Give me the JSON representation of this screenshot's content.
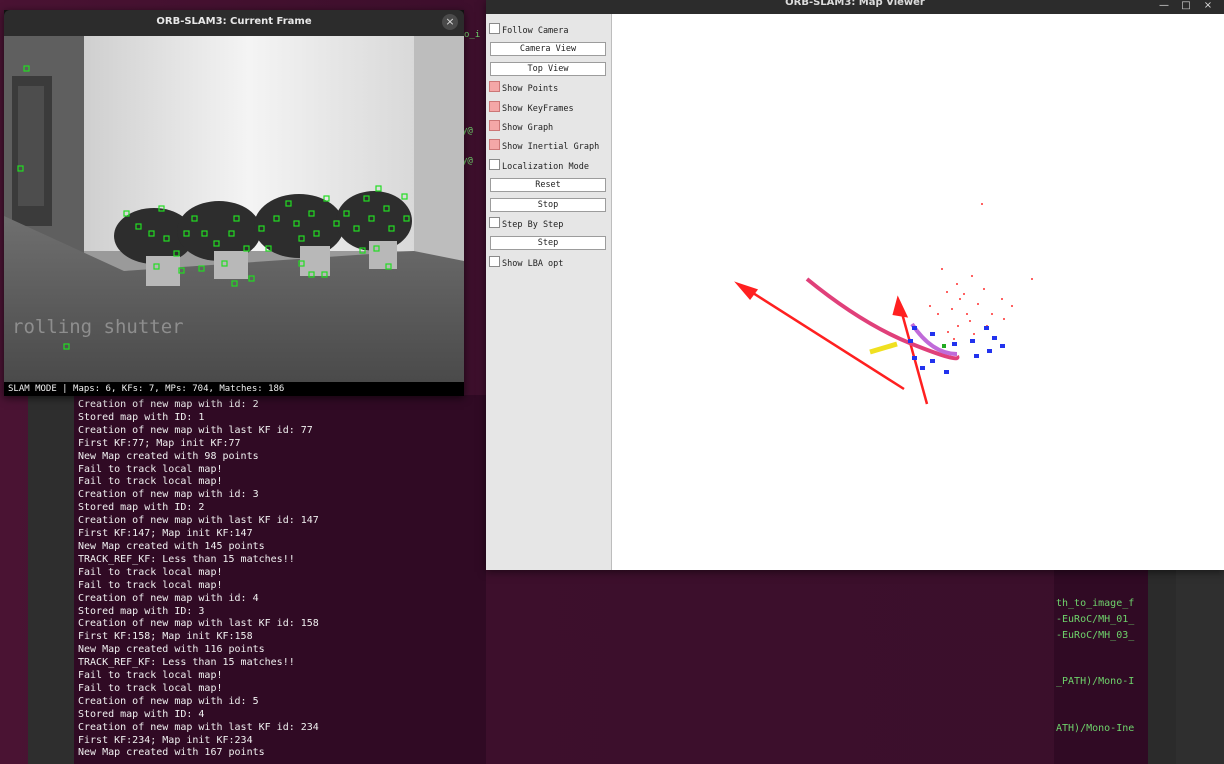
{
  "frame_window": {
    "title": "ORB-SLAM3: Current Frame",
    "close_symbol": "×",
    "overlay_text": "rolling shutter",
    "status": "SLAM MODE |  Maps: 6, KFs: 7, MPs: 704, Matches: 186"
  },
  "map_window": {
    "title": "ORB-SLAM3: Map Viewer",
    "controls": [
      "—",
      "□",
      "×"
    ],
    "panel": {
      "follow_camera": "Follow Camera",
      "camera_view": "Camera View",
      "top_view": "Top View",
      "show_points": "Show Points",
      "show_keyframes": "Show KeyFrames",
      "show_graph": "Show Graph",
      "show_inertial_graph": "Show Inertial Graph",
      "localization_mode": "Localization Mode",
      "reset": "Reset",
      "stop": "Stop",
      "step_by_step": "Step By Step",
      "step": "Step",
      "show_lba_opt": "Show LBA opt"
    }
  },
  "terminal": {
    "lines": [
      "Creation of new map with id: 2",
      "Stored map with ID: 1",
      "Creation of new map with last KF id: 77",
      "First KF:77; Map init KF:77",
      "New Map created with 98 points",
      "Fail to track local map!",
      "Fail to track local map!",
      "Creation of new map with id: 3",
      "Stored map with ID: 2",
      "Creation of new map with last KF id: 147",
      "First KF:147; Map init KF:147",
      "New Map created with 145 points",
      "TRACK_REF_KF: Less than 15 matches!!",
      "Fail to track local map!",
      "Fail to track local map!",
      "Creation of new map with id: 4",
      "Stored map with ID: 3",
      "Creation of new map with last KF id: 158",
      "First KF:158; Map init KF:158",
      "New Map created with 116 points",
      "TRACK_REF_KF: Less than 15 matches!!",
      "Fail to track local map!",
      "Fail to track local map!",
      "Creation of new map with id: 5",
      "Stored map with ID: 4",
      "Creation of new map with last KF id: 234",
      "First KF:234; Map init KF:234",
      "New Map created with 167 points"
    ]
  },
  "terminal2": {
    "lines": [
      "th_to_image_f",
      "-EuRoC/MH_01_",
      "-EuRoC/MH_03_",
      "_PATH)/Mono-I",
      "ATH)/Mono-Ine"
    ]
  },
  "side_fragments": [
    "o_i",
    "y@",
    "y@"
  ],
  "colors": {
    "terminal_bg": "#300a24",
    "feature_green": "#22dd22",
    "trajectory_red": "#ff2020",
    "trajectory_pink": "#e0407a",
    "keyframe_blue": "#2233ee",
    "checked_box": "#f4a7a7"
  }
}
